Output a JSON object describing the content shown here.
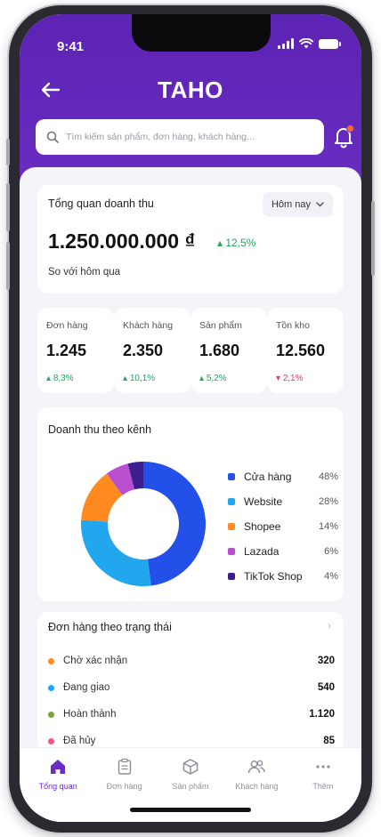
{
  "status_bar": {
    "time": "9:41"
  },
  "header": {
    "title": "TAHO"
  },
  "search": {
    "placeholder": "Tìm kiếm sản phẩm, đơn hàng, khách hàng..."
  },
  "revenue": {
    "title": "Tổng quan doanh thu",
    "period": "Hôm nay",
    "amount": "1.250.000.000 ₫",
    "change": "12,5%",
    "compare": "So với hôm qua"
  },
  "stats": [
    {
      "label": "Đơn hàng",
      "value": "1.245",
      "change": "8,3%",
      "trend": "up"
    },
    {
      "label": "Khách hàng",
      "value": "2.350",
      "change": "10,1%",
      "trend": "up"
    },
    {
      "label": "Sản phẩm",
      "value": "1.680",
      "change": "5,2%",
      "trend": "up"
    },
    {
      "label": "Tồn kho",
      "value": "12.560",
      "change": "2,1%",
      "trend": "down"
    }
  ],
  "channels": {
    "title": "Doanh thu theo kênh",
    "items": [
      {
        "name": "Cửa hàng",
        "percent": "48%",
        "value": 48,
        "color": "#2350e8"
      },
      {
        "name": "Website",
        "percent": "28%",
        "value": 28,
        "color": "#22a7ef"
      },
      {
        "name": "Shopee",
        "percent": "14%",
        "value": 14,
        "color": "#ff8a1f"
      },
      {
        "name": "Lazada",
        "percent": "6%",
        "value": 6,
        "color": "#b94fcf"
      },
      {
        "name": "TikTok Shop",
        "percent": "4%",
        "value": 4,
        "color": "#3b1f8e"
      }
    ]
  },
  "order_status": {
    "title": "Đơn hàng theo trạng thái",
    "items": [
      {
        "name": "Chờ xác nhận",
        "count": "320",
        "color": "#ff8a1f"
      },
      {
        "name": "Đang giao",
        "count": "540",
        "color": "#22a7ef"
      },
      {
        "name": "Hoàn thành",
        "count": "1.120",
        "color": "#7fa03a"
      },
      {
        "name": "Đã hủy",
        "count": "85",
        "color": "#f0568a"
      }
    ]
  },
  "tabs": [
    {
      "label": "Tổng quan",
      "icon": "home-icon",
      "active": true
    },
    {
      "label": "Đơn hàng",
      "icon": "clipboard-icon"
    },
    {
      "label": "Sản phẩm",
      "icon": "box-icon"
    },
    {
      "label": "Khách hàng",
      "icon": "users-icon"
    },
    {
      "label": "Thêm",
      "icon": "more-icon"
    }
  ],
  "colors": {
    "brand": "#6b2ec3",
    "up": "#21a65b",
    "down": "#e23d52"
  }
}
